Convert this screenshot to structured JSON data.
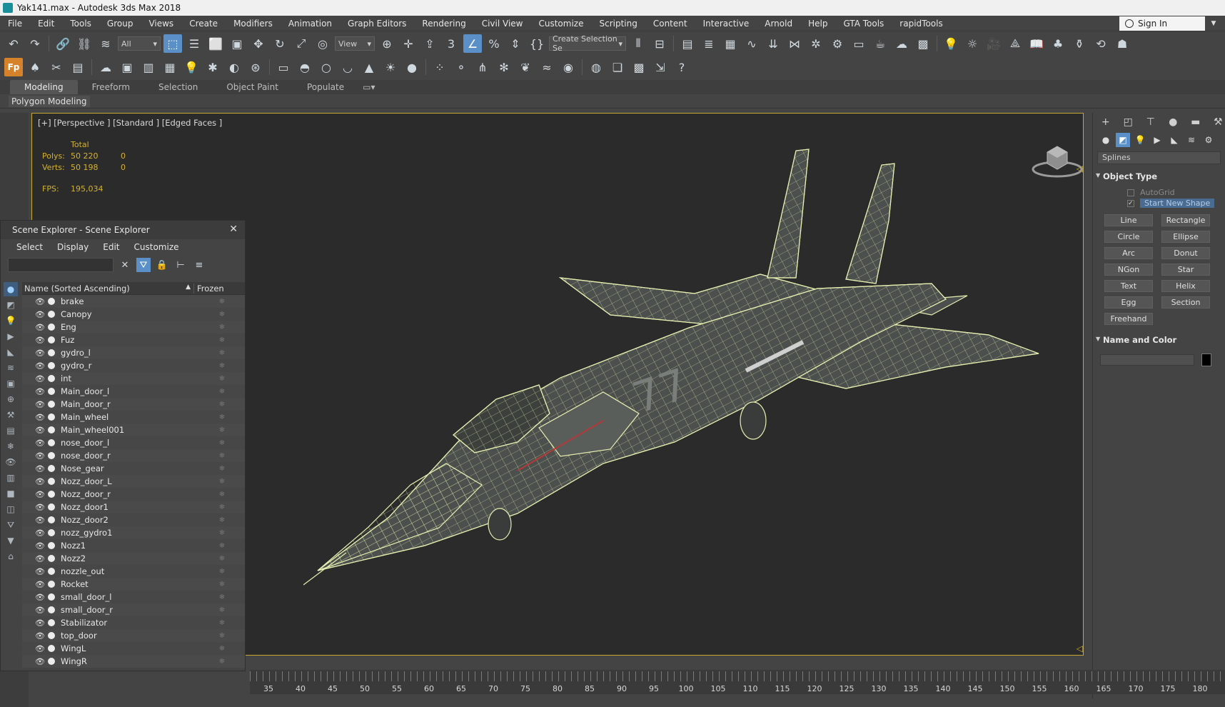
{
  "window": {
    "title": "Yak141.max - Autodesk 3ds Max 2018"
  },
  "menu": [
    "File",
    "Edit",
    "Tools",
    "Group",
    "Views",
    "Create",
    "Modifiers",
    "Animation",
    "Graph Editors",
    "Rendering",
    "Civil View",
    "Customize",
    "Scripting",
    "Content",
    "Interactive",
    "Arnold",
    "Help",
    "GTA Tools",
    "rapidTools"
  ],
  "signin": {
    "label": "Sign In"
  },
  "toolbar": {
    "filter_value": "All",
    "view_value": "View",
    "selection_set": "Create Selection Se"
  },
  "ribbon": {
    "tabs": [
      "Modeling",
      "Freeform",
      "Selection",
      "Object Paint",
      "Populate"
    ],
    "panel_label": "Polygon Modeling"
  },
  "viewport": {
    "label": "[+] [Perspective ] [Standard ] [Edged Faces ]",
    "stats": {
      "total_label": "Total",
      "polys_label": "Polys:",
      "polys_value": "50 220",
      "polys_sel": "0",
      "verts_label": "Verts:",
      "verts_value": "50 198",
      "verts_sel": "0",
      "fps_label": "FPS:",
      "fps_value": "195,034"
    }
  },
  "scene_explorer": {
    "title": "Scene Explorer - Scene Explorer",
    "menu": [
      "Select",
      "Display",
      "Edit",
      "Customize"
    ],
    "col_name": "Name (Sorted Ascending)",
    "col_frozen": "Frozen",
    "items": [
      "brake",
      "Canopy",
      "Eng",
      "Fuz",
      "gydro_l",
      "gydro_r",
      "int",
      "Main_door_l",
      "Main_door_r",
      "Main_wheel",
      "Main_wheel001",
      "nose_door_l",
      "nose_door_r",
      "Nose_gear",
      "Nozz_door_L",
      "Nozz_door_r",
      "Nozz_door1",
      "Nozz_door2",
      "nozz_gydro1",
      "Nozz1",
      "Nozz2",
      "nozzle_out",
      "Rocket",
      "small_door_l",
      "small_door_r",
      "Stabilizator",
      "top_door",
      "WingL",
      "WingR"
    ]
  },
  "command_panel": {
    "category": "Splines",
    "object_type_title": "Object Type",
    "autogrid": "AutoGrid",
    "start_new_shape": "Start New Shape",
    "buttons": [
      "Line",
      "Rectangle",
      "Circle",
      "Ellipse",
      "Arc",
      "Donut",
      "NGon",
      "Star",
      "Text",
      "Helix",
      "Egg",
      "Section",
      "Freehand"
    ],
    "name_color_title": "Name and Color"
  },
  "timeline": {
    "ticks": [
      "35",
      "40",
      "45",
      "50",
      "55",
      "60",
      "65",
      "70",
      "75",
      "80",
      "85",
      "90",
      "95",
      "100",
      "105",
      "110",
      "115",
      "120",
      "125",
      "130",
      "135",
      "140",
      "145",
      "150",
      "155",
      "160",
      "165",
      "170",
      "175",
      "180"
    ]
  },
  "colors": {
    "accent": "#5b8fc7",
    "viewport_border": "#c7a82f",
    "wireframe": "#e6efb0",
    "stats": "#d4b22e"
  }
}
